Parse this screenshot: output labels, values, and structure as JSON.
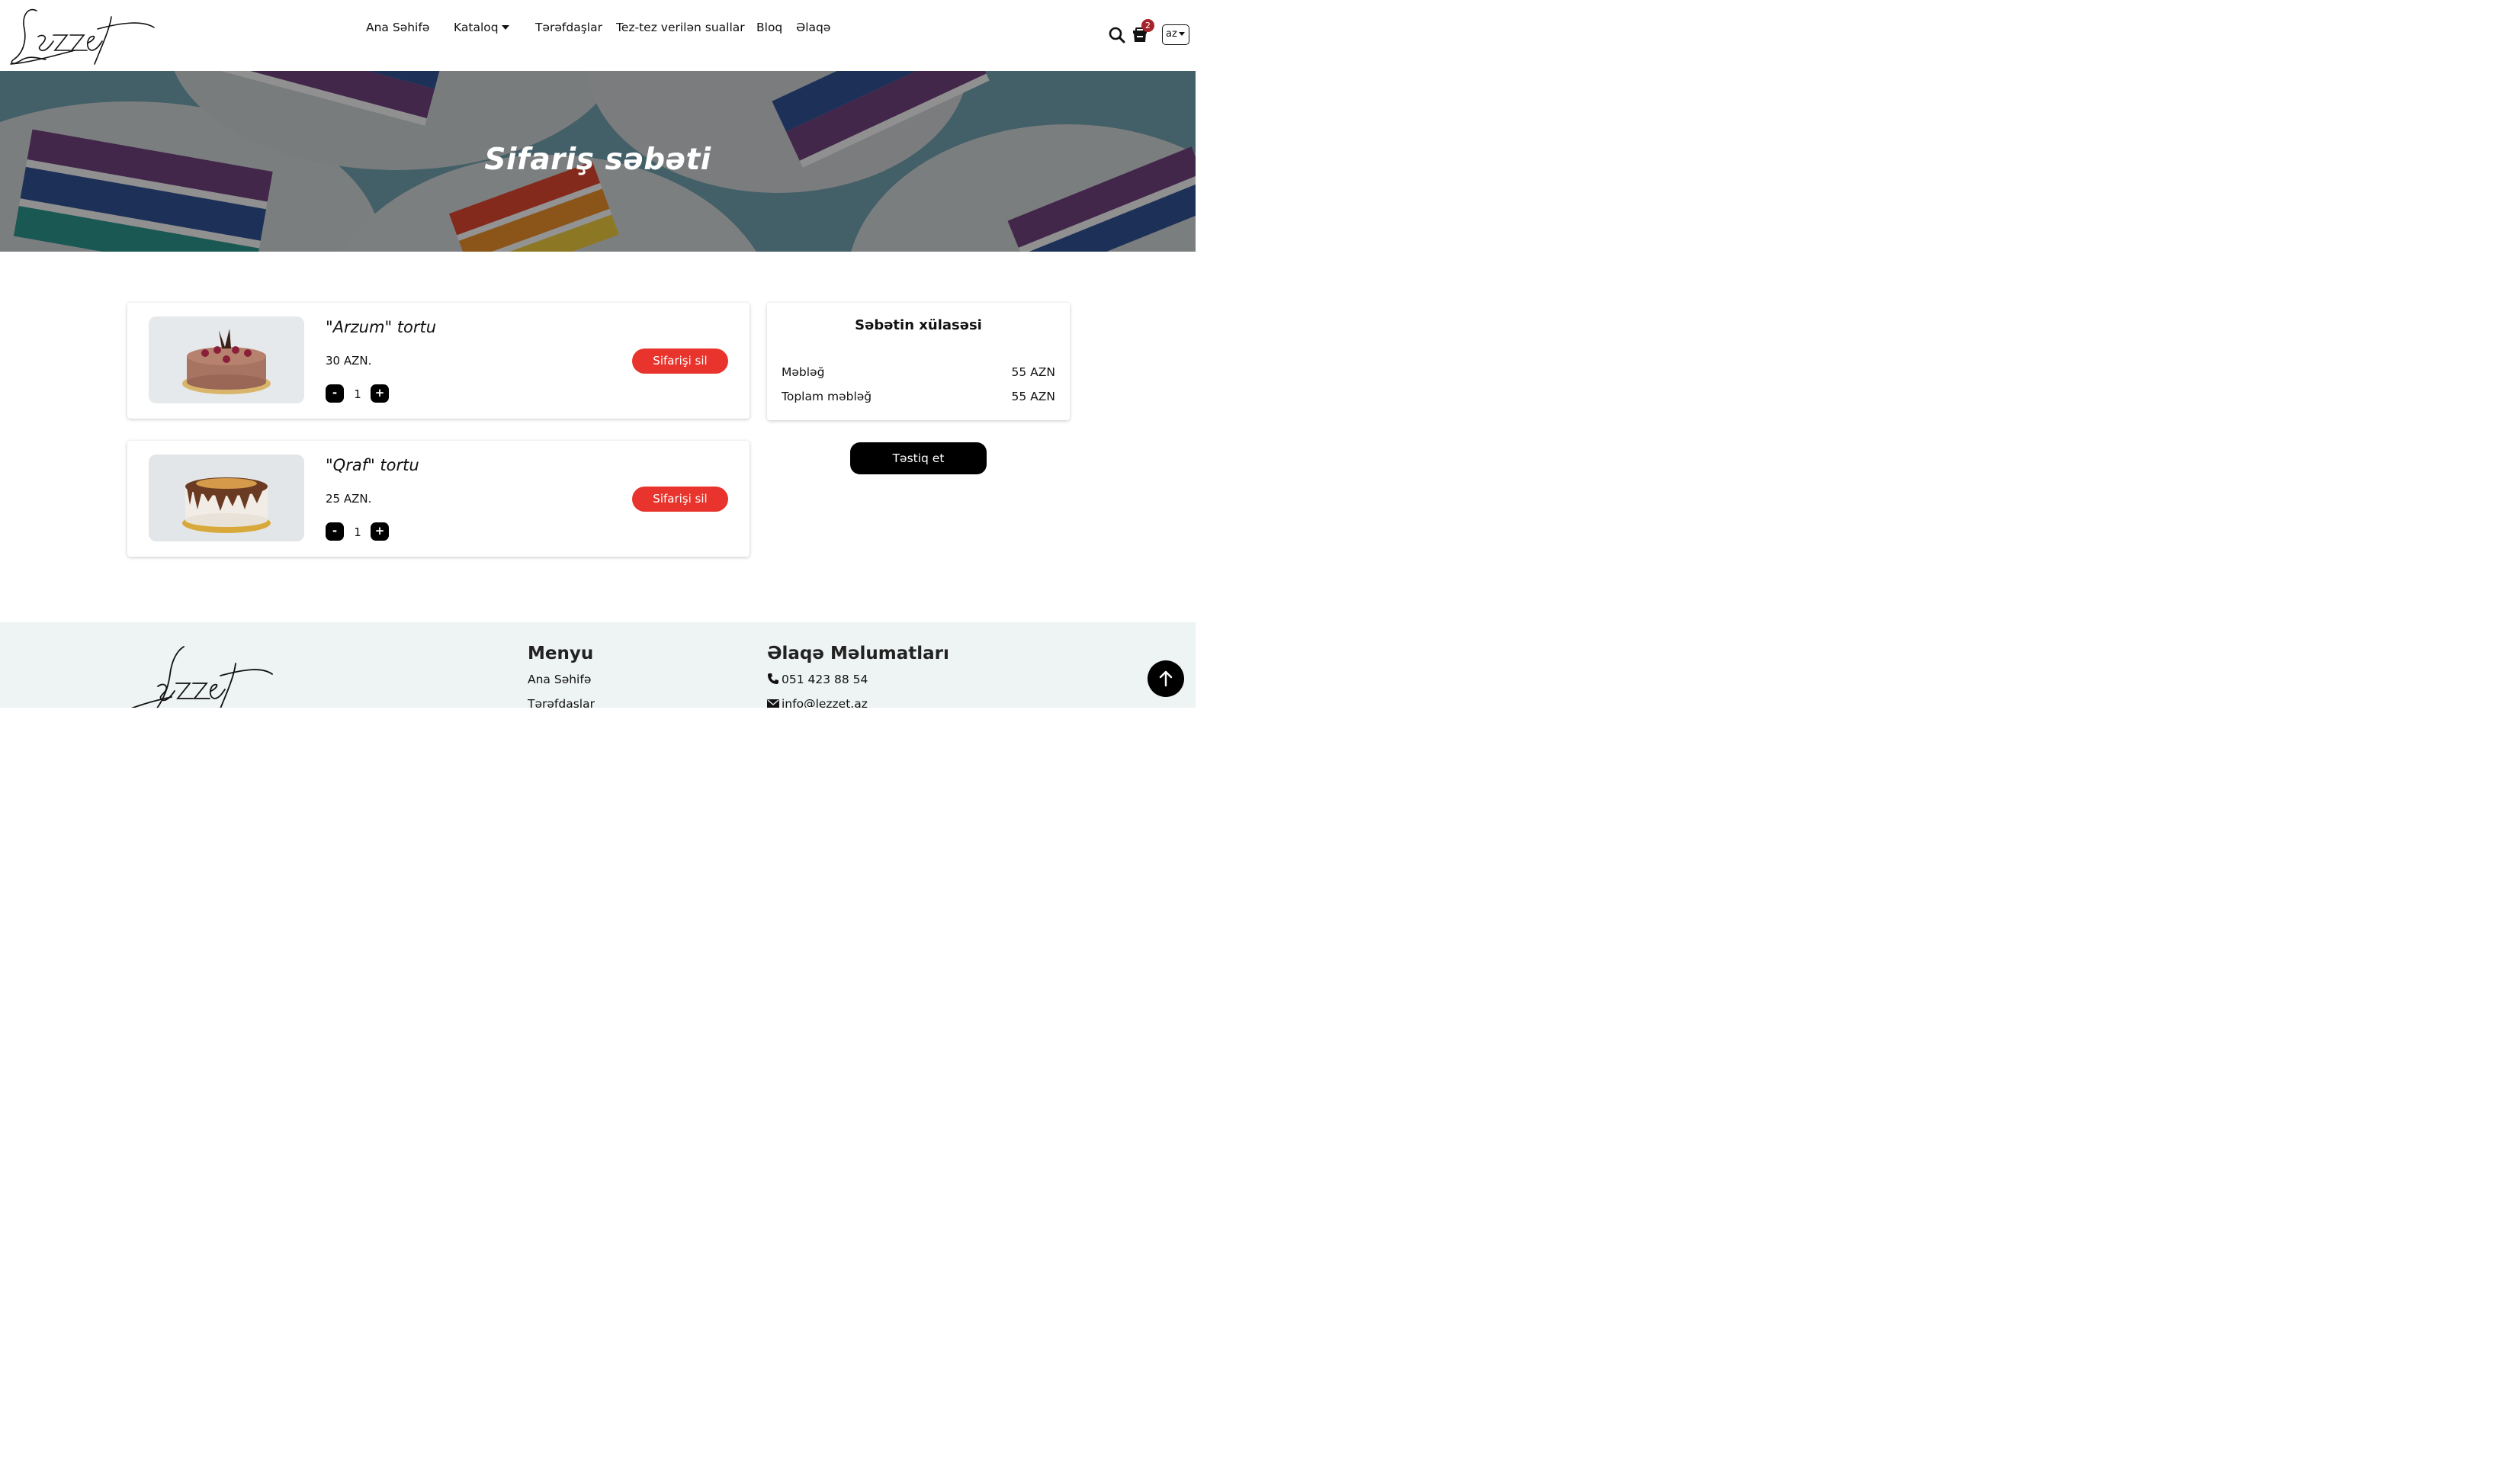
{
  "header": {
    "logo_text": "Ləzzət",
    "nav": [
      "Ana Səhifə",
      "Kataloq",
      "Tərəfdaşlar",
      "Tez-tez verilən suallar",
      "Bloq",
      "Əlaqə"
    ],
    "cart_count": "2",
    "language": "az",
    "icons": [
      "search-icon",
      "cart-icon",
      "chevron-down-icon"
    ]
  },
  "hero": {
    "title": "Sifariş səbəti"
  },
  "cart": {
    "items": [
      {
        "name": "\"Arzum\" tortu",
        "price": "30 AZN.",
        "quantity": "1",
        "minus": "-",
        "plus": "+",
        "delete_label": "Sifarişi sil"
      },
      {
        "name": "\"Qraf\" tortu",
        "price": "25 AZN.",
        "quantity": "1",
        "minus": "-",
        "plus": "+",
        "delete_label": "Sifarişi sil"
      }
    ]
  },
  "summary": {
    "title": "Səbətin xülasəsi",
    "rows": [
      {
        "label": "Məbləğ",
        "value": "55 AZN"
      },
      {
        "label": "Toplam məbləğ",
        "value": "55 AZN"
      }
    ],
    "confirm_label": "Təstiq et"
  },
  "footer": {
    "logo_text": "Ləzzət",
    "menu_title": "Menyu",
    "menu_items": [
      "Ana Səhifə",
      "Tərəfdaşlar"
    ],
    "contact_title": "Əlaqə Məlumatları",
    "phone": "051 423 88 54",
    "email": "info@lezzet.az"
  },
  "colors": {
    "accent_red": "#e8342c",
    "badge": "#a6242a",
    "footer_bg": "#eef3f4",
    "button_black": "#000000"
  }
}
